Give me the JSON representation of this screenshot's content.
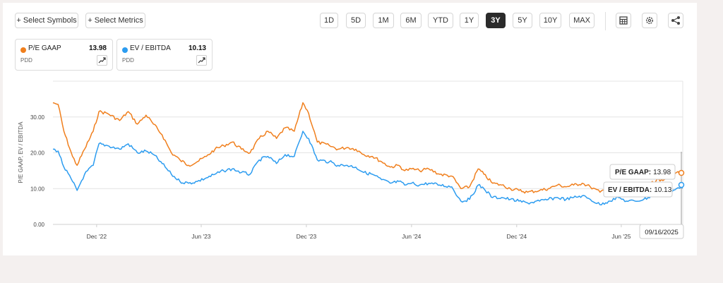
{
  "toolbar": {
    "select_symbols": "+ Select Symbols",
    "select_metrics": "+ Select Metrics",
    "ranges": [
      "1D",
      "5D",
      "1M",
      "6M",
      "YTD",
      "1Y",
      "3Y",
      "5Y",
      "10Y",
      "MAX"
    ],
    "active_range": "3Y",
    "icons": [
      "table-icon",
      "gear-icon",
      "share-icon"
    ]
  },
  "metrics": [
    {
      "name": "P/E GAAP",
      "value": "13.98",
      "symbol": "PDD",
      "color": "#f07f1d"
    },
    {
      "name": "EV / EBITDA",
      "value": "10.13",
      "symbol": "PDD",
      "color": "#2c9cf0"
    }
  ],
  "tooltip": {
    "pe_label": "P/E GAAP:",
    "pe_value": "13.98",
    "ev_label": "EV / EBITDA:",
    "ev_value": "10.13",
    "date": "09/16/2025"
  },
  "chart_data": {
    "type": "line",
    "ylabel": "P/E GAAP, EV / EBITDA",
    "ylim": [
      0,
      40
    ],
    "yticks": [
      "0.00",
      "10.00",
      "20.00",
      "30.00"
    ],
    "yticks_values": [
      0,
      10,
      20,
      30
    ],
    "x_range": [
      "2022-09-16",
      "2025-09-16"
    ],
    "xtick_labels": [
      "Dec '22",
      "Jun '23",
      "Dec '23",
      "Jun '24",
      "Dec '24",
      "Jun '25"
    ],
    "xtick_dates": [
      "2022-12-01",
      "2023-06-01",
      "2023-12-01",
      "2024-06-01",
      "2024-12-01",
      "2025-06-01"
    ],
    "grid": true,
    "series": [
      {
        "name": "P/E GAAP",
        "color": "#f07f1d",
        "x": [
          "2022-09-16",
          "2022-09-25",
          "2022-10-05",
          "2022-10-20",
          "2022-10-28",
          "2022-11-10",
          "2022-11-25",
          "2022-12-05",
          "2022-12-20",
          "2023-01-10",
          "2023-01-25",
          "2023-02-10",
          "2023-02-25",
          "2023-03-10",
          "2023-03-25",
          "2023-04-10",
          "2023-04-25",
          "2023-05-10",
          "2023-05-25",
          "2023-06-10",
          "2023-06-25",
          "2023-07-10",
          "2023-07-25",
          "2023-08-10",
          "2023-08-25",
          "2023-09-10",
          "2023-09-25",
          "2023-10-10",
          "2023-10-25",
          "2023-11-10",
          "2023-11-25",
          "2023-12-05",
          "2023-12-20",
          "2024-01-10",
          "2024-01-25",
          "2024-02-10",
          "2024-02-25",
          "2024-03-10",
          "2024-03-25",
          "2024-04-10",
          "2024-04-25",
          "2024-05-10",
          "2024-05-20",
          "2024-06-01",
          "2024-06-15",
          "2024-07-01",
          "2024-07-20",
          "2024-08-10",
          "2024-08-26",
          "2024-09-10",
          "2024-09-25",
          "2024-10-05",
          "2024-10-20",
          "2024-11-05",
          "2024-11-20",
          "2024-12-05",
          "2024-12-20",
          "2025-01-10",
          "2025-01-25",
          "2025-02-10",
          "2025-02-25",
          "2025-03-10",
          "2025-03-25",
          "2025-04-08",
          "2025-04-25",
          "2025-05-10",
          "2025-05-27",
          "2025-06-10",
          "2025-06-25",
          "2025-07-10",
          "2025-07-25",
          "2025-08-10",
          "2025-08-25",
          "2025-09-05",
          "2025-09-16"
        ],
        "y": [
          34,
          33.5,
          26,
          19,
          16.5,
          21,
          26,
          31.5,
          31,
          29,
          31.5,
          28,
          30.5,
          28,
          25,
          20,
          18,
          16.5,
          17.5,
          19,
          21,
          22,
          23,
          21,
          20,
          24,
          26,
          24,
          27,
          26,
          34,
          31,
          23,
          22,
          21,
          21.5,
          21,
          19.5,
          19,
          17.5,
          16,
          16.5,
          15,
          15.5,
          15,
          15.5,
          14,
          13.5,
          10,
          10.5,
          15.5,
          14,
          11.5,
          11,
          10,
          9.5,
          9,
          9.5,
          10,
          11,
          10.5,
          11,
          11.5,
          10.5,
          9,
          10.5,
          11,
          10,
          10,
          11,
          12,
          12.5,
          13.5,
          14.5,
          13.98
        ]
      },
      {
        "name": "EV / EBITDA",
        "color": "#2c9cf0",
        "x": [
          "2022-09-16",
          "2022-09-25",
          "2022-10-05",
          "2022-10-20",
          "2022-10-28",
          "2022-11-10",
          "2022-11-25",
          "2022-12-05",
          "2022-12-20",
          "2023-01-10",
          "2023-01-25",
          "2023-02-10",
          "2023-02-25",
          "2023-03-10",
          "2023-03-25",
          "2023-04-10",
          "2023-04-25",
          "2023-05-10",
          "2023-05-25",
          "2023-06-10",
          "2023-06-25",
          "2023-07-10",
          "2023-07-25",
          "2023-08-10",
          "2023-08-25",
          "2023-09-10",
          "2023-09-25",
          "2023-10-10",
          "2023-10-25",
          "2023-11-10",
          "2023-11-25",
          "2023-12-05",
          "2023-12-20",
          "2024-01-10",
          "2024-01-25",
          "2024-02-10",
          "2024-02-25",
          "2024-03-10",
          "2024-03-25",
          "2024-04-10",
          "2024-04-25",
          "2024-05-10",
          "2024-05-20",
          "2024-06-01",
          "2024-06-15",
          "2024-07-01",
          "2024-07-20",
          "2024-08-10",
          "2024-08-26",
          "2024-09-10",
          "2024-09-25",
          "2024-10-05",
          "2024-10-20",
          "2024-11-05",
          "2024-11-20",
          "2024-12-05",
          "2024-12-20",
          "2025-01-10",
          "2025-01-25",
          "2025-02-10",
          "2025-02-25",
          "2025-03-10",
          "2025-03-25",
          "2025-04-08",
          "2025-04-25",
          "2025-05-10",
          "2025-05-27",
          "2025-06-10",
          "2025-06-25",
          "2025-07-10",
          "2025-07-25",
          "2025-08-10",
          "2025-08-25",
          "2025-09-05",
          "2025-09-16"
        ],
        "y": [
          21,
          20.5,
          16,
          12,
          9.5,
          14,
          16.5,
          22.5,
          22,
          21,
          22.5,
          20,
          20.5,
          19.5,
          17,
          14,
          12,
          11.5,
          12,
          13,
          14,
          15,
          15.5,
          14.5,
          14,
          18,
          19,
          17,
          19.5,
          19,
          26,
          24,
          18,
          17.5,
          16.5,
          16.5,
          16,
          14.5,
          14,
          12.5,
          11.5,
          12,
          11,
          11.5,
          11,
          11.5,
          11,
          10.5,
          6.5,
          7,
          11,
          10,
          7.5,
          7.5,
          7,
          6.5,
          6,
          6.5,
          7,
          7.5,
          7,
          7.5,
          8,
          7,
          5.5,
          6.5,
          7.5,
          6.5,
          6.5,
          7,
          8,
          8.5,
          9,
          10,
          10.13
        ]
      }
    ]
  }
}
